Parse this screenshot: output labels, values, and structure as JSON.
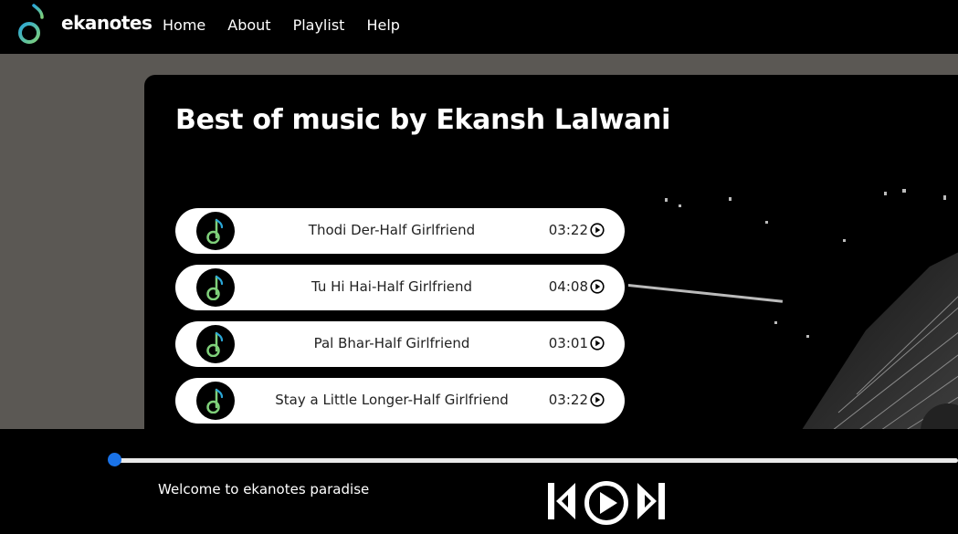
{
  "navbar": {
    "brand": "ekanotes",
    "logo_icon": "music-note-icon",
    "links": [
      "Home",
      "About",
      "Playlist",
      "Help"
    ]
  },
  "playlist": {
    "title": "Best of music by Ekansh Lalwani",
    "songs": [
      {
        "title": "Thodi Der-Half Girlfriend",
        "duration": "03:22"
      },
      {
        "title": "Tu Hi Hai-Half Girlfriend",
        "duration": "04:08"
      },
      {
        "title": "Pal Bhar-Half Girlfriend",
        "duration": "03:01"
      },
      {
        "title": "Stay a Little Longer-Half Girlfriend",
        "duration": "03:22"
      }
    ]
  },
  "player": {
    "now_playing": "Welcome to ekanotes paradise",
    "progress": 0,
    "controls": [
      "previous-icon",
      "play-icon",
      "next-icon"
    ]
  },
  "colors": {
    "accent": "#1a73e8",
    "logo_gradient": [
      "#2aa7d8",
      "#7fd07a"
    ],
    "page_bg": "#5b5854"
  }
}
